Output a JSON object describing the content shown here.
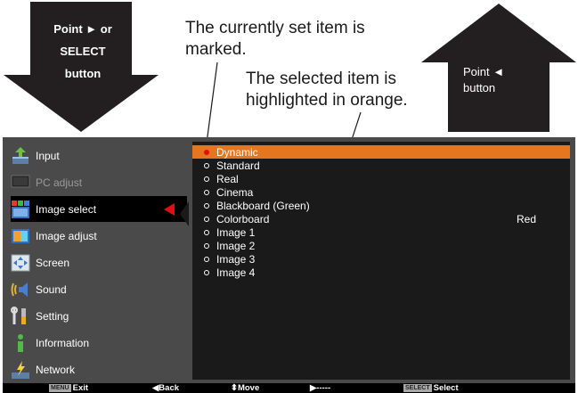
{
  "callouts": {
    "left_arrow_lines": [
      "Point ► or",
      "SELECT",
      "button"
    ],
    "right_arrow_lines": [
      "Point ◄",
      "button"
    ],
    "annotation_marked_lines": [
      "The currently set item is",
      "marked."
    ],
    "annotation_highlight_lines": [
      "The selected item is",
      "highlighted in orange."
    ]
  },
  "menu": {
    "items": [
      {
        "label": "Input",
        "icon": "input-icon",
        "state": "normal"
      },
      {
        "label": "PC adjust",
        "icon": "pc-adjust-icon",
        "state": "disabled"
      },
      {
        "label": "Image select",
        "icon": "image-select-icon",
        "state": "active"
      },
      {
        "label": "Image adjust",
        "icon": "image-adjust-icon",
        "state": "normal"
      },
      {
        "label": "Screen",
        "icon": "screen-icon",
        "state": "normal"
      },
      {
        "label": "Sound",
        "icon": "sound-icon",
        "state": "normal"
      },
      {
        "label": "Setting",
        "icon": "setting-icon",
        "state": "normal"
      },
      {
        "label": "Information",
        "icon": "information-icon",
        "state": "normal"
      },
      {
        "label": "Network",
        "icon": "network-icon",
        "state": "normal"
      }
    ]
  },
  "options": {
    "items": [
      {
        "label": "Dynamic",
        "value": ""
      },
      {
        "label": "Standard",
        "value": ""
      },
      {
        "label": "Real",
        "value": ""
      },
      {
        "label": "Cinema",
        "value": ""
      },
      {
        "label": "Blackboard (Green)",
        "value": ""
      },
      {
        "label": "Colorboard",
        "value": "Red"
      },
      {
        "label": "Image 1",
        "value": ""
      },
      {
        "label": "Image 2",
        "value": ""
      },
      {
        "label": "Image 3",
        "value": ""
      },
      {
        "label": "Image 4",
        "value": ""
      }
    ]
  },
  "bottom_bar": {
    "menu_key": "MENU",
    "exit": "Exit",
    "back": "◀Back",
    "move": "⬍Move",
    "next": "▶-----",
    "select_key": "SELECT",
    "select": "Select"
  },
  "colors": {
    "highlight": "#e3761e",
    "pointer": "#e01010",
    "menu_bg": "#4a4a4a",
    "options_bg": "#1a1a1a"
  }
}
